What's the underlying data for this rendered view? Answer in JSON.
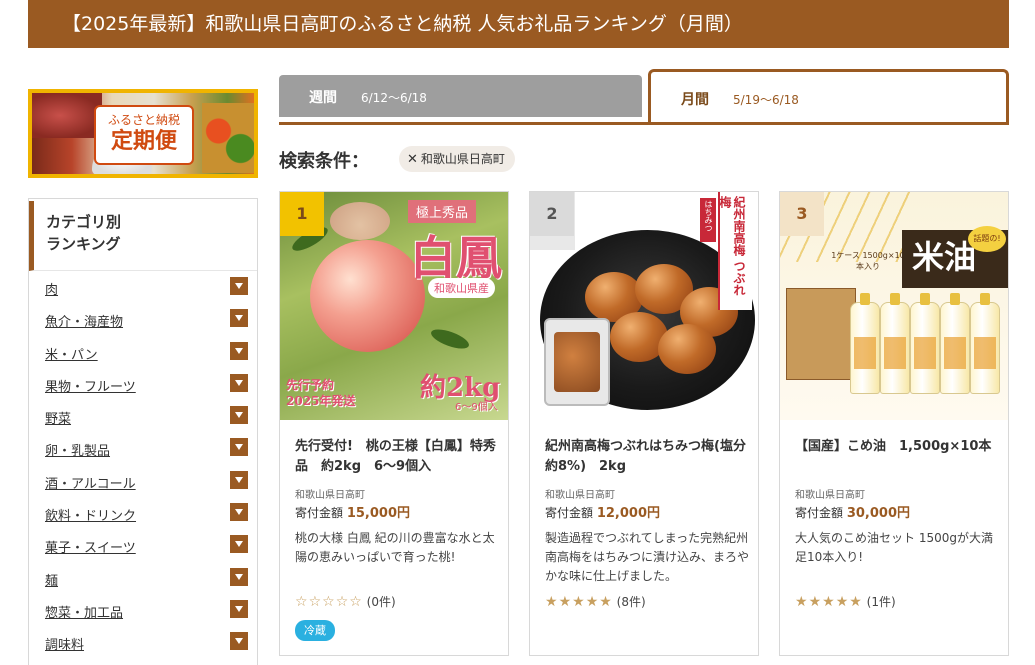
{
  "header": {
    "title": "【2025年最新】和歌山県日高町のふるさと納税 人気お礼品ランキング（月間）"
  },
  "banner": {
    "line1": "ふるさと納税",
    "line2": "定期便"
  },
  "sidebar": {
    "heading_line1": "カテゴリ別",
    "heading_line2": "ランキング",
    "items": [
      {
        "label": "肉"
      },
      {
        "label": "魚介・海産物"
      },
      {
        "label": "米・パン"
      },
      {
        "label": "果物・フルーツ"
      },
      {
        "label": "野菜"
      },
      {
        "label": "卵・乳製品"
      },
      {
        "label": "酒・アルコール"
      },
      {
        "label": "飲料・ドリンク"
      },
      {
        "label": "菓子・スイーツ"
      },
      {
        "label": "麺"
      },
      {
        "label": "惣菜・加工品"
      },
      {
        "label": "調味料"
      }
    ]
  },
  "tabs": {
    "weekly": {
      "label": "週間",
      "range": "6/12〜6/18"
    },
    "monthly": {
      "label": "月間",
      "range": "5/19〜6/18"
    }
  },
  "search": {
    "label": "検索条件：",
    "chip_label": "和歌山県日高町",
    "chip_icon": "close-icon"
  },
  "common": {
    "price_label": "寄付金額"
  },
  "products": [
    {
      "rank": "1",
      "title": "先行受付!　桃の王様【白鳳】特秀品　約2kg　6〜9個入",
      "town": "和歌山県日高町",
      "price": "15,000円",
      "description": "桃の大様 白鳳 紀の川の豊富な水と太陽の恵みいっぱいで育った桃!",
      "rating": 0,
      "review_count": "(0件)",
      "badge": "冷蔵",
      "image": {
        "t1": "極上秀品",
        "t2": "白鳳",
        "t3": "和歌山県産",
        "t4a": "先行予約",
        "t4b": "2025年発送",
        "t5": "約2kg",
        "t6": "6〜9個入"
      }
    },
    {
      "rank": "2",
      "title": "紀州南高梅つぶれはちみつ梅(塩分約8%)　2kg",
      "town": "和歌山県日高町",
      "price": "12,000円",
      "description": "製造過程でつぶれてしまった完熟紀州南高梅をはちみつに漬け込み、まろやかな味に仕上げました。",
      "rating": 5,
      "review_count": "(8件)",
      "badge": "",
      "image": {
        "pack_label": "つぶれ梅",
        "side_text": "紀州南高梅 つぶれ梅",
        "side_red": "はちみつ"
      }
    },
    {
      "rank": "3",
      "title": "【国産】こめ油　1,500g×10本",
      "town": "和歌山県日高町",
      "price": "30,000円",
      "description": "大人気のこめ油セット 1500gが大満足10本入り!",
      "rating": 5,
      "review_count": "(1件)",
      "badge": "",
      "image": {
        "big": "米油",
        "tag": "話題の!",
        "small": "1ケース 1500g×10本入り"
      }
    }
  ],
  "colors": {
    "brand": "#9a5a22",
    "star": "#c8a060",
    "badge": "#2ab0e0"
  }
}
